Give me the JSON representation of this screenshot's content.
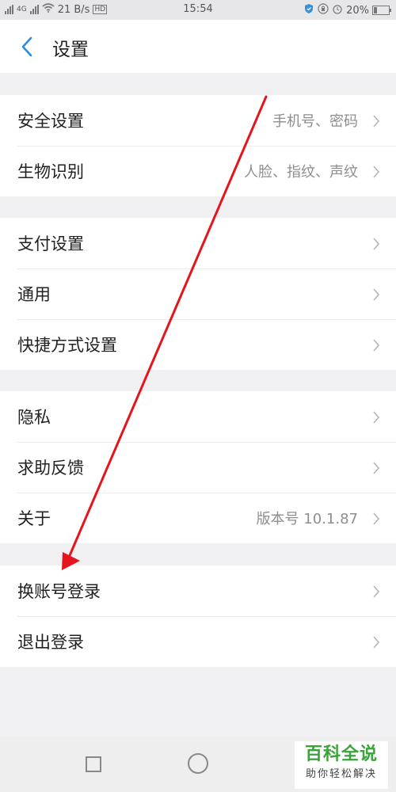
{
  "status_bar": {
    "network_label": "4G",
    "speed": "21 B/s",
    "hd_label": "HD",
    "time": "15:54",
    "battery": "20%",
    "battery_level": 0.2
  },
  "header": {
    "title": "设置",
    "back_icon": "chevron-left-icon"
  },
  "groups": [
    {
      "items": [
        {
          "label": "安全设置",
          "value": "手机号、密码"
        },
        {
          "label": "生物识别",
          "value": "人脸、指纹、声纹"
        }
      ]
    },
    {
      "items": [
        {
          "label": "支付设置",
          "value": ""
        },
        {
          "label": "通用",
          "value": ""
        },
        {
          "label": "快捷方式设置",
          "value": ""
        }
      ]
    },
    {
      "items": [
        {
          "label": "隐私",
          "value": ""
        },
        {
          "label": "求助反馈",
          "value": ""
        },
        {
          "label": "关于",
          "value": "版本号 10.1.87"
        }
      ]
    },
    {
      "items": [
        {
          "label": "换账号登录",
          "value": ""
        },
        {
          "label": "退出登录",
          "value": ""
        }
      ]
    }
  ],
  "annotation": {
    "arrow_color": "#e8141c"
  },
  "nav_bar": {
    "icons": [
      "recent-apps-icon",
      "home-icon"
    ]
  },
  "watermark": {
    "title": "百科全说",
    "subtitle": "助你轻松解决"
  },
  "colors": {
    "accent": "#2a8de0",
    "watermark_green": "#3aa33a"
  }
}
